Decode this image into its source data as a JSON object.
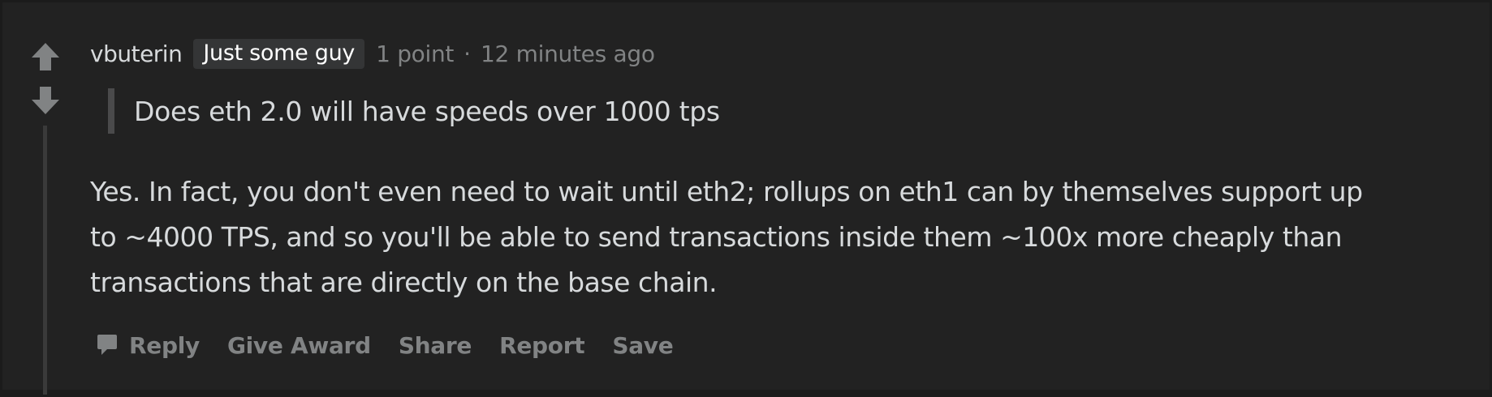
{
  "comment": {
    "author": "vbuterin",
    "flair": "Just some guy",
    "score": "1 point",
    "separator": "·",
    "timestamp": "12 minutes ago",
    "quote": "Does eth 2.0 will have speeds over 1000 tps",
    "body_lines": [
      "Yes. In fact, you don't even need to wait until eth2; rollups on eth1 can by themselves support up",
      "to ~4000 TPS, and so you'll be able to send transactions inside them ~100x more cheaply than",
      "transactions that are directly on the base chain."
    ]
  },
  "actions": {
    "reply": "Reply",
    "give_award": "Give Award",
    "share": "Share",
    "report": "Report",
    "save": "Save"
  },
  "icons": {
    "upvote": "upvote-arrow-icon",
    "downvote": "downvote-arrow-icon",
    "reply": "speech-bubble-icon"
  },
  "colors": {
    "background": "#222222",
    "text": "#d7dadc",
    "muted": "#818384",
    "flair_bg": "#343536"
  }
}
